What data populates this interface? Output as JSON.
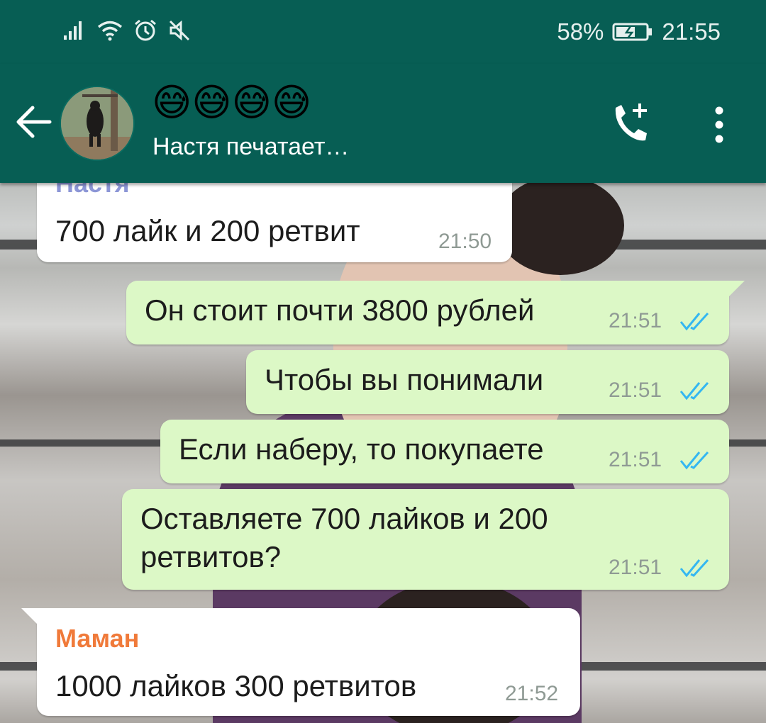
{
  "status_bar": {
    "battery": "58%",
    "time": "21:55",
    "icons_left": [
      "signal-icon",
      "wifi-icon",
      "alarm-icon",
      "mute-icon"
    ],
    "icons_right": [
      "battery-icon"
    ]
  },
  "header": {
    "title_emoji": "😅😅😅😅",
    "status": "Настя печатает…",
    "icons": [
      "back-arrow-icon",
      "add-call-icon",
      "more-vert-icon"
    ]
  },
  "messages": [
    {
      "direction": "in",
      "sender": "Настя",
      "text": "700 лайк и 200 ретвит",
      "time": "21:50"
    },
    {
      "direction": "out",
      "text": "Он стоит почти 3800 рублей",
      "time": "21:51",
      "status": "read"
    },
    {
      "direction": "out",
      "text": "Чтобы вы понимали",
      "time": "21:51",
      "status": "read"
    },
    {
      "direction": "out",
      "text": "Если наберу, то покупаете",
      "time": "21:51",
      "status": "read"
    },
    {
      "direction": "out",
      "text_lines": [
        "Оставляете 700 лайков и 200",
        "ретвитов?"
      ],
      "time": "21:51",
      "status": "read"
    },
    {
      "direction": "in",
      "sender": "Маман",
      "text": "1000 лайков 300 ретвитов",
      "time": "21:52"
    }
  ],
  "colors": {
    "header": "#075e54",
    "outgoing_bubble": "#dcf8c6",
    "incoming_bubble": "#ffffff",
    "read_tick": "#34b7f1",
    "sender_nastya": "#8c96d6",
    "sender_maman": "#f07a3a"
  }
}
